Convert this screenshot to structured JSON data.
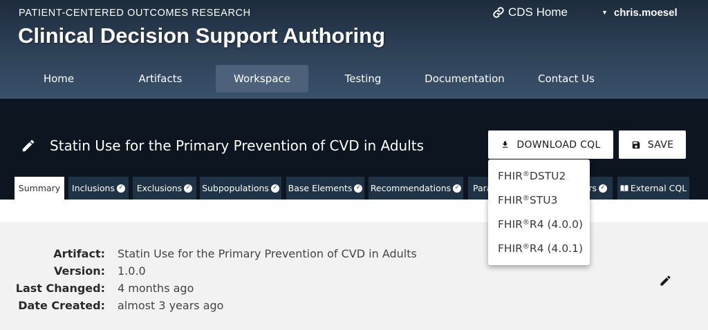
{
  "header": {
    "supertitle": "PATIENT-CENTERED OUTCOMES RESEARCH",
    "title": "Clinical Decision Support Authoring",
    "cds_home_label": "CDS Home",
    "user_name": "chris.moesel"
  },
  "nav": {
    "items": [
      {
        "label": "Home"
      },
      {
        "label": "Artifacts"
      },
      {
        "label": "Workspace"
      },
      {
        "label": "Testing"
      },
      {
        "label": "Documentation"
      },
      {
        "label": "Contact Us"
      }
    ],
    "active": "Workspace"
  },
  "artifact": {
    "title": "Statin Use for the Primary Prevention of CVD in Adults"
  },
  "actions": {
    "download_label": "DOWNLOAD CQL",
    "save_label": "SAVE"
  },
  "tabs": [
    {
      "label": "Summary"
    },
    {
      "label": "Inclusions"
    },
    {
      "label": "Exclusions"
    },
    {
      "label": "Subpopulations"
    },
    {
      "label": "Base Elements"
    },
    {
      "label": "Recommendations"
    },
    {
      "label": "Para"
    },
    {
      "label": "rs"
    },
    {
      "label": "External CQL"
    }
  ],
  "download_menu": {
    "items": [
      {
        "prefix": "FHIR",
        "mark": "®",
        "suffix": "DSTU2"
      },
      {
        "prefix": "FHIR",
        "mark": "®",
        "suffix": "STU3"
      },
      {
        "prefix": "FHIR",
        "mark": "®",
        "suffix": "R4 (4.0.0)"
      },
      {
        "prefix": "FHIR",
        "mark": "®",
        "suffix": "R4 (4.0.1)"
      }
    ]
  },
  "details": {
    "rows": [
      {
        "label": "Artifact:",
        "value": "Statin Use for the Primary Prevention of CVD in Adults"
      },
      {
        "label": "Version:",
        "value": "1.0.0"
      },
      {
        "label": "Last Changed:",
        "value": "4 months ago"
      },
      {
        "label": "Date Created:",
        "value": "almost 3 years ago"
      }
    ]
  },
  "icons": {
    "cds_home": "link-icon",
    "user": "caret-down-icon",
    "edit_title": "pencil-icon",
    "download": "download-icon",
    "save": "floppy-disk-icon",
    "tab_complete": "check-circle-icon",
    "external_cql": "book-icon",
    "edit_details": "pencil-icon"
  },
  "colors": {
    "header_top": "#1d2c3d",
    "header_bottom": "#3a516b",
    "nav_active": "#4d627a",
    "title_band": "#0d1620",
    "tab_bg": "#1e3346",
    "content_bg": "#f2f2f2"
  }
}
